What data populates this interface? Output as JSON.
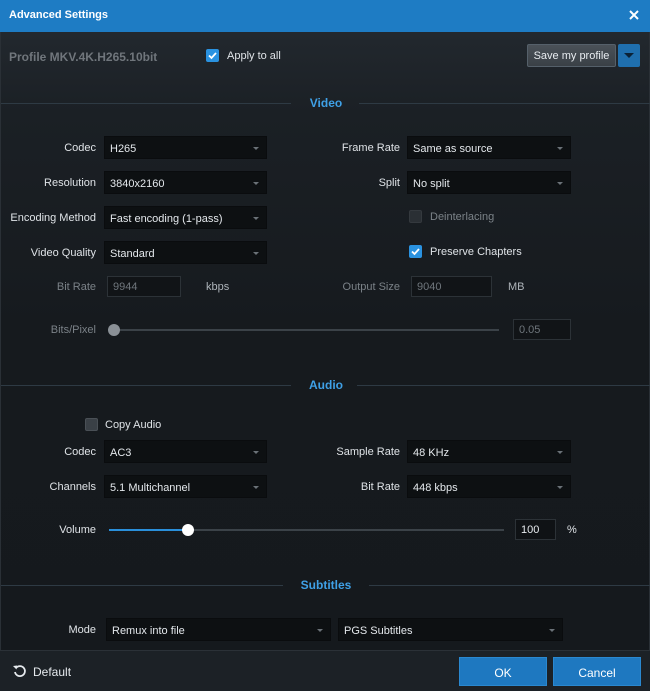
{
  "window": {
    "title": "Advanced Settings"
  },
  "profile": {
    "label": "Profile  MKV.4K.H265.10bit",
    "apply_to_all_label": "Apply to all",
    "apply_to_all_checked": true,
    "save_label": "Save my profile"
  },
  "video": {
    "section_title": "Video",
    "codec_label": "Codec",
    "codec_value": "H265",
    "resolution_label": "Resolution",
    "resolution_value": "3840x2160",
    "encoding_label": "Encoding Method",
    "encoding_value": "Fast encoding (1-pass)",
    "quality_label": "Video Quality",
    "quality_value": "Standard",
    "bitrate_label": "Bit Rate",
    "bitrate_value": "9944",
    "bitrate_unit": "kbps",
    "framerate_label": "Frame Rate",
    "framerate_value": "Same as source",
    "split_label": "Split",
    "split_value": "No split",
    "deinterlacing_label": "Deinterlacing",
    "deinterlacing_checked": false,
    "chapters_label": "Preserve Chapters",
    "chapters_checked": true,
    "outputsize_label": "Output Size",
    "outputsize_value": "9040",
    "outputsize_unit": "MB",
    "bitspixel_label": "Bits/Pixel",
    "bitspixel_value": "0.05",
    "bitspixel_level": 0.0
  },
  "audio": {
    "section_title": "Audio",
    "copy_audio_label": "Copy Audio",
    "copy_audio_checked": false,
    "codec_label": "Codec",
    "codec_value": "AC3",
    "channels_label": "Channels",
    "channels_value": "5.1 Multichannel",
    "samplerate_label": "Sample Rate",
    "samplerate_value": "48 KHz",
    "bitrate_label": "Bit Rate",
    "bitrate_value": "448 kbps",
    "volume_label": "Volume",
    "volume_value": "100",
    "volume_unit": "%",
    "volume_level": 0.2
  },
  "subtitles": {
    "section_title": "Subtitles",
    "mode_label": "Mode",
    "mode_value": "Remux into file",
    "format_value": "PGS Subtitles"
  },
  "footer": {
    "default_label": "Default",
    "ok_label": "OK",
    "cancel_label": "Cancel"
  },
  "colors": {
    "accent": "#1e7cc4",
    "section_title": "#3fa0e6",
    "background": "#161a1e"
  },
  "icons": {
    "close": "close-icon",
    "reset": "reset-icon",
    "dropdown": "chevron-down-icon",
    "checkbox": "check-icon"
  }
}
